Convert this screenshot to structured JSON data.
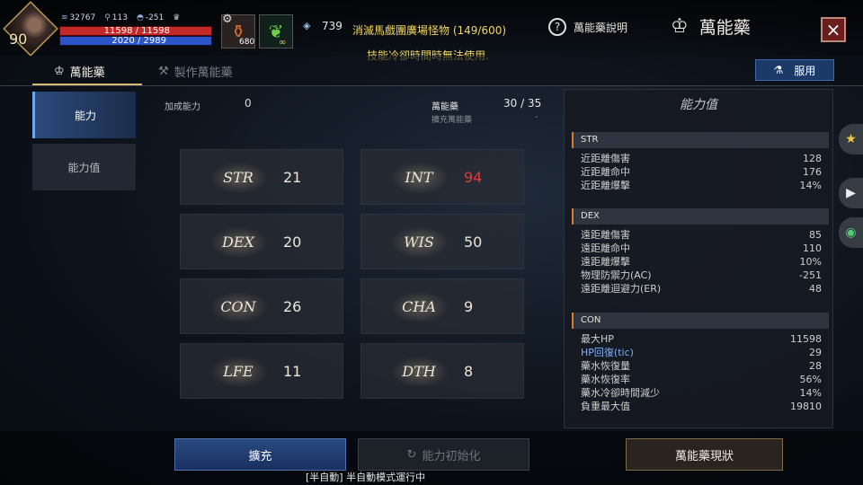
{
  "player": {
    "level": "90",
    "stat1": "32767",
    "stat2": "113",
    "stat3": "-251",
    "hp": "11598 / 11598",
    "mp": "2020 / 2989"
  },
  "hud": {
    "potion_count": "680",
    "leaf_count": "∞",
    "gem_count": "739",
    "notice1": "消滅馬戲團廣場怪物 (149/600)",
    "notice2": "技能冷卻時間時無法使用."
  },
  "header": {
    "help_label": "萬能藥說明",
    "title": "萬能藥",
    "close_icon": "×"
  },
  "tabs": [
    {
      "label": "萬能藥"
    },
    {
      "label": "製作萬能藥"
    }
  ],
  "use_button": "服用",
  "side_nav": [
    {
      "label": "能力"
    },
    {
      "label": "能力值"
    }
  ],
  "info": {
    "bonus_label": "加成能力",
    "bonus_value": "0",
    "pill_label": "萬能藥",
    "pill_value": "30 / 35",
    "expand_label": "擴充萬能藥",
    "expand_value": "-"
  },
  "stats": [
    {
      "name": "STR",
      "value": "21"
    },
    {
      "name": "INT",
      "value": "94"
    },
    {
      "name": "DEX",
      "value": "20"
    },
    {
      "name": "WIS",
      "value": "50"
    },
    {
      "name": "CON",
      "value": "26"
    },
    {
      "name": "CHA",
      "value": "9"
    },
    {
      "name": "LFE",
      "value": "11"
    },
    {
      "name": "DTH",
      "value": "8"
    }
  ],
  "right_panel": {
    "title": "能力值",
    "sections": [
      {
        "head": "STR",
        "rows": [
          {
            "k": "近距離傷害",
            "v": "128"
          },
          {
            "k": "近距離命中",
            "v": "176"
          },
          {
            "k": "近距離爆擊",
            "v": "14%"
          }
        ]
      },
      {
        "head": "DEX",
        "rows": [
          {
            "k": "遠距離傷害",
            "v": "85"
          },
          {
            "k": "遠距離命中",
            "v": "110"
          },
          {
            "k": "遠距離爆擊",
            "v": "10%"
          },
          {
            "k": "物理防禦力(AC)",
            "v": "-251"
          },
          {
            "k": "遠距離迴避力(ER)",
            "v": "48"
          }
        ]
      },
      {
        "head": "CON",
        "rows": [
          {
            "k": "最大HP",
            "v": "11598"
          },
          {
            "k": "HP回復(tic)",
            "v": "29"
          },
          {
            "k": "藥水恢復量",
            "v": "28"
          },
          {
            "k": "藥水恢復率",
            "v": "56%"
          },
          {
            "k": "藥水冷卻時間減少",
            "v": "14%"
          },
          {
            "k": "負重最大值",
            "v": "19810"
          }
        ]
      }
    ]
  },
  "bottom": {
    "expand": "擴充",
    "reset": "能力初始化",
    "status": "萬能藥現狀",
    "auto_status": "[半自動] 半自動模式運行中"
  },
  "colors": {
    "accent_blue": "#2a4a80",
    "hp_red": "#c22a2a",
    "mp_blue": "#2a54c8",
    "highlight_red": "#e23a3a",
    "notice_yellow": "#f2d860"
  }
}
